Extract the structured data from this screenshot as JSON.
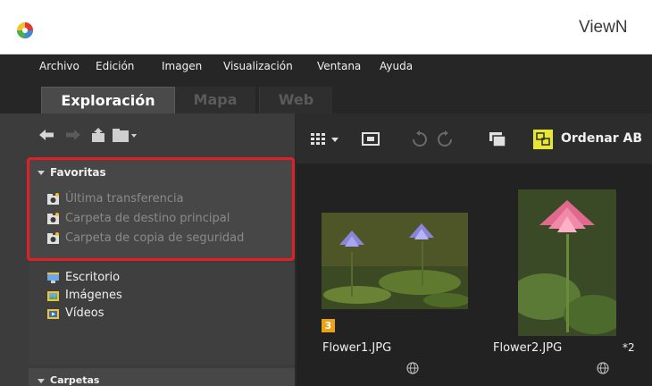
{
  "window": {
    "title": "ViewN"
  },
  "menubar": [
    "Archivo",
    "Edición",
    "Imagen",
    "Visualización",
    "Ventana",
    "Ayuda"
  ],
  "tabs": [
    {
      "label": "Exploración",
      "active": true
    },
    {
      "label": "Mapa",
      "active": false
    },
    {
      "label": "Web",
      "active": false
    }
  ],
  "favorites": {
    "header": "Favoritas",
    "items": [
      "Última transferencia",
      "Carpeta de destino principal",
      "Carpeta de copia de seguridad"
    ]
  },
  "places": [
    "Escritorio",
    "Imágenes",
    "Vídeos"
  ],
  "folders": {
    "header": "Carpetas"
  },
  "toolbar": {
    "sort_label": "Ordenar AB"
  },
  "thumbnails": [
    {
      "filename": "Flower1.JPG",
      "rating": "3",
      "extra": ""
    },
    {
      "filename": "Flower2.JPG",
      "rating": "",
      "extra": "*2"
    }
  ],
  "colors": {
    "highlight": "#e31e24",
    "rating_badge": "#e8a317",
    "active_toggle": "#e6e633"
  }
}
